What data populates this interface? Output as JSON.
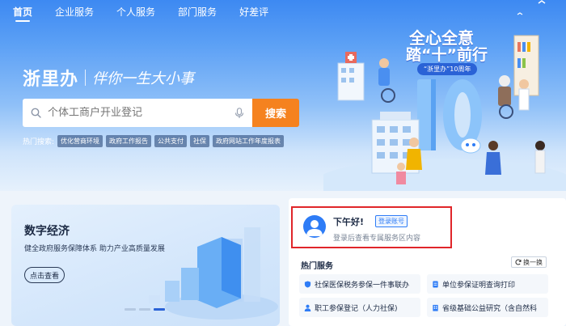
{
  "nav": {
    "items": [
      "首页",
      "企业服务",
      "个人服务",
      "部门服务",
      "好差评"
    ],
    "active_index": 0
  },
  "brand": {
    "title": "浙里办",
    "slogan": "伴你一生大小事"
  },
  "search": {
    "placeholder": "个体工商户开业登记",
    "button": "搜索"
  },
  "hot_search": {
    "label": "热门搜索:",
    "tags": [
      "优化营商环境",
      "政府工作报告",
      "公共支付",
      "社保",
      "政府网站工作年度报表"
    ]
  },
  "banner": {
    "line1": "全心全意",
    "line2": "踏“十”前行",
    "sub": "“浙里办”10周年",
    "big_number": "10"
  },
  "digital": {
    "title": "数字经济",
    "desc": "健全政府服务保障体系 助力产业高质量发展",
    "button": "点击查看",
    "slides": 3,
    "active_slide": 3
  },
  "user": {
    "greeting": "下午好!",
    "login_label": "登录账号",
    "hint": "登录后查看专属服务区内容"
  },
  "hot_services": {
    "title": "热门服务",
    "swap": "换一换",
    "items": [
      {
        "label": "社保医保税务参保一件事联办",
        "icon": "shield-icon"
      },
      {
        "label": "单位参保证明查询打印",
        "icon": "document-icon"
      },
      {
        "label": "职工参保登记（人力社保)",
        "icon": "user-icon"
      },
      {
        "label": "省级基础公益研究（含自然科",
        "icon": "building-icon"
      }
    ]
  },
  "colors": {
    "accent": "#2e7cf6",
    "search_button": "#f5821f",
    "highlight_border": "#e0262a"
  }
}
